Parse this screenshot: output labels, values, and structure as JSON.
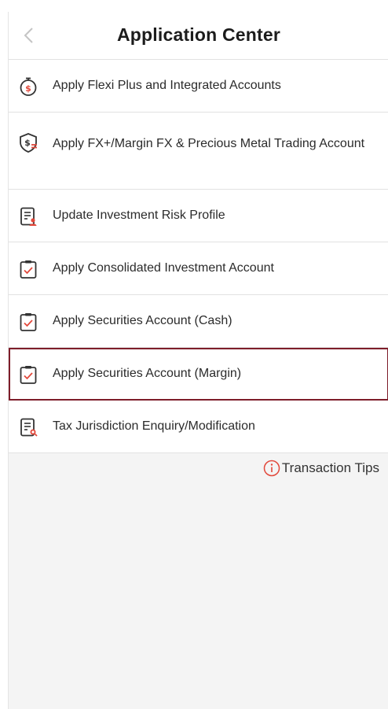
{
  "header": {
    "title": "Application Center",
    "back_icon": "chevron-left-icon"
  },
  "items": [
    {
      "label": "Apply Flexi Plus and Integrated Accounts",
      "icon": "stopwatch-dollar-icon"
    },
    {
      "label": "Apply FX+/Margin FX & Precious Metal Trading Account",
      "icon": "shield-dollar-icon"
    },
    {
      "label": "Update Investment Risk Profile",
      "icon": "document-user-icon"
    },
    {
      "label": "Apply Consolidated Investment Account",
      "icon": "clipboard-check-icon"
    },
    {
      "label": "Apply Securities Account (Cash)",
      "icon": "clipboard-check-icon"
    },
    {
      "label": "Apply Securities Account (Margin)",
      "icon": "clipboard-check-icon"
    },
    {
      "label": "Tax Jurisdiction Enquiry/Modification",
      "icon": "document-search-icon"
    }
  ],
  "footer": {
    "tips_label": "Transaction Tips",
    "tips_icon": "info-circle-icon"
  },
  "colors": {
    "accent": "#e2483b",
    "highlight_border": "#7e1d2a",
    "background": "#f4f4f4"
  }
}
